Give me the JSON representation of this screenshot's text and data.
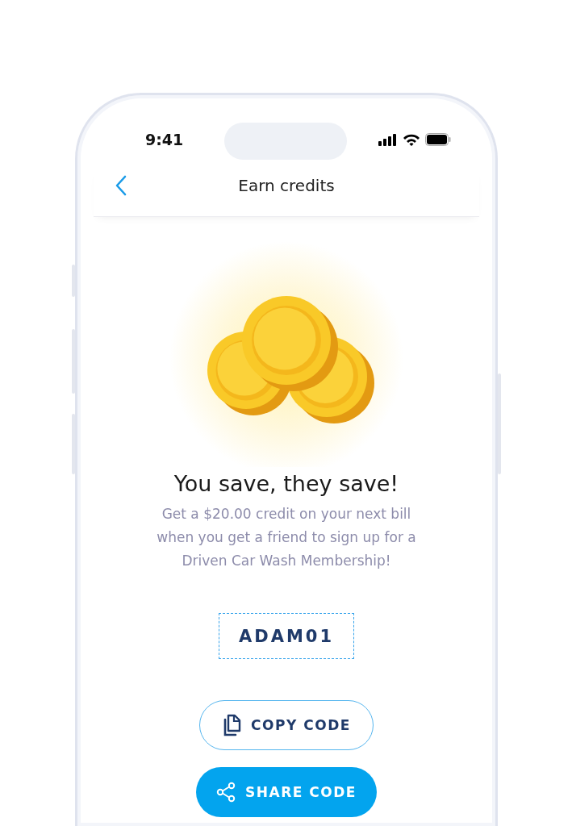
{
  "status_bar": {
    "time": "9:41"
  },
  "header": {
    "title": "Earn credits"
  },
  "promo": {
    "heading": "You save, they save!",
    "description": "Get a $20.00 credit on your next bill when you get a friend to sign up for a Driven Car Wash Membership!"
  },
  "referral_code": "ADAM01",
  "buttons": [
    {
      "kind": "outline",
      "label": "COPY CODE"
    },
    {
      "kind": "filled",
      "label": "SHARE CODE"
    }
  ]
}
